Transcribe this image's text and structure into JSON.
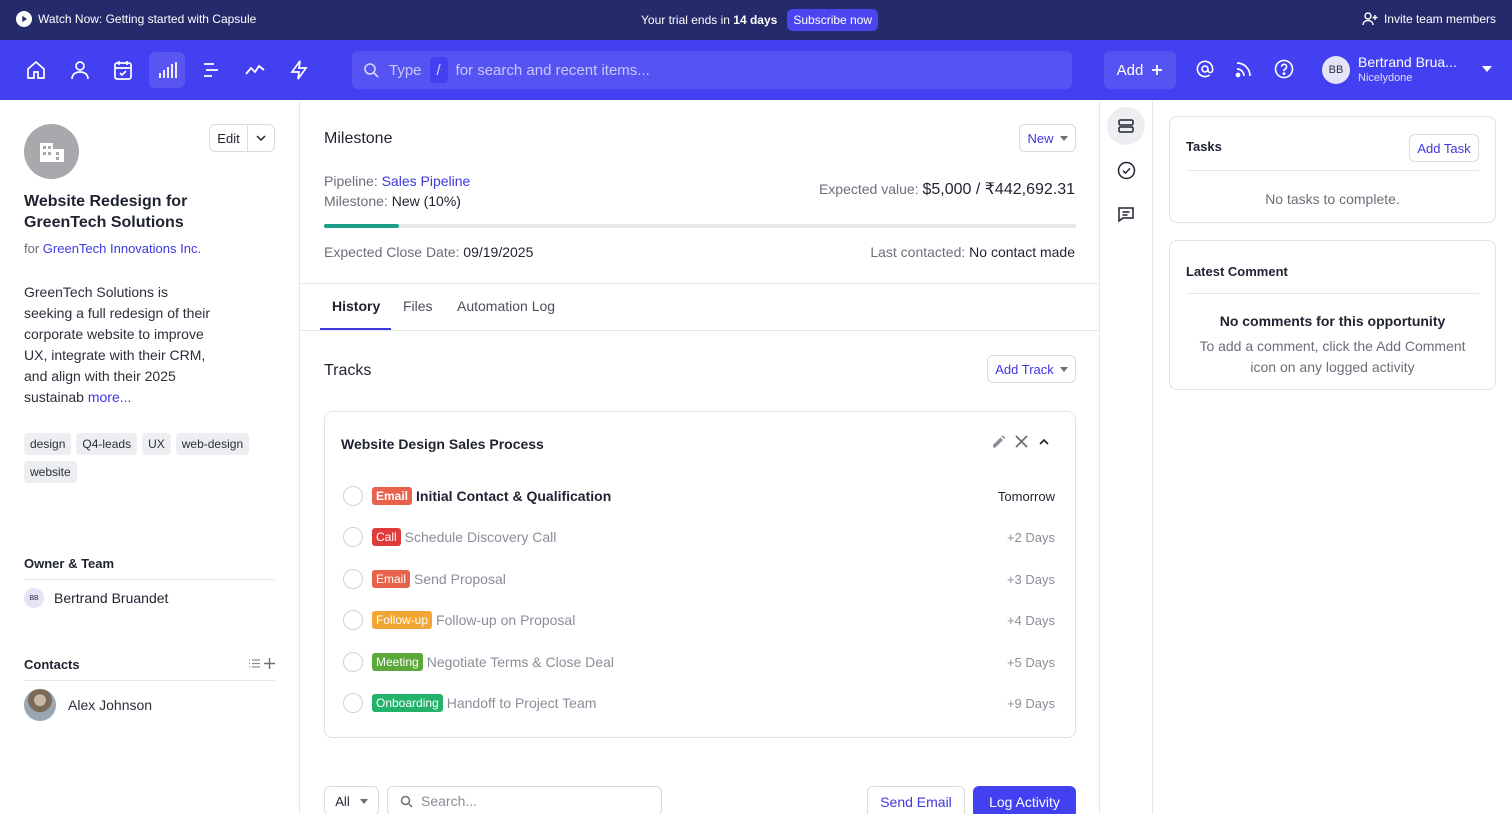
{
  "promo": {
    "watch_label": "Watch Now: Getting started with Capsule",
    "trial_prefix": "Your trial ends in",
    "trial_days": "14 days",
    "subscribe_label": "Subscribe now",
    "invite_label": "Invite team members"
  },
  "nav": {
    "icons": [
      "home-icon",
      "person-icon",
      "calendar-icon",
      "pipeline-icon",
      "projects-icon",
      "reports-icon",
      "workflow-icon"
    ],
    "search_prefix": "Type",
    "search_slash": "/",
    "search_suffix": "for search and recent items...",
    "add_label": "Add",
    "user_initials": "BB",
    "user_name": "Bertrand Brua...",
    "user_org": "Nicelydone"
  },
  "opportunity": {
    "edit_label": "Edit",
    "title": "Website Redesign for GreenTech Solutions",
    "for_prefix": "for",
    "for_org": "GreenTech Innovations Inc.",
    "description": "GreenTech Solutions is seeking a full redesign of their corporate website to improve UX, integrate with their CRM, and align with their 2025 sustainab",
    "more_label": "more...",
    "tags": [
      "design",
      "Q4-leads",
      "UX",
      "web-design",
      "website"
    ],
    "owner_title": "Owner & Team",
    "owner_initials": "BB",
    "owner_name": "Bertrand Bruandet",
    "contacts_title": "Contacts",
    "contact_name": "Alex Johnson"
  },
  "milestone": {
    "heading": "Milestone",
    "stage_button": "New",
    "pipeline_label": "Pipeline:",
    "pipeline_value": "Sales Pipeline",
    "milestone_label": "Milestone:",
    "milestone_value": "New (10%)",
    "expected_label": "Expected value:",
    "expected_value": "$5,000 / ₹442,692.31",
    "progress_percent": 10,
    "close_label": "Expected Close Date:",
    "close_value": "09/19/2025",
    "contacted_label": "Last contacted:",
    "contacted_value": "No contact made"
  },
  "tabs": [
    "History",
    "Files",
    "Automation Log"
  ],
  "tracks": {
    "title": "Tracks",
    "add_label": "Add Track",
    "card_title": "Website Design Sales Process",
    "items": [
      {
        "badge": "Email",
        "name": "Initial Contact & Qualification",
        "due": "Tomorrow"
      },
      {
        "badge": "Call",
        "name": "Schedule Discovery Call",
        "due": "+2 Days"
      },
      {
        "badge": "Email",
        "name": "Send Proposal",
        "due": "+3 Days"
      },
      {
        "badge": "Follow-up",
        "name": "Follow-up on Proposal",
        "due": "+4 Days"
      },
      {
        "badge": "Meeting",
        "name": "Negotiate Terms & Close Deal",
        "due": "+5 Days"
      },
      {
        "badge": "Onboarding",
        "name": "Handoff to Project Team",
        "due": "+9 Days"
      }
    ]
  },
  "activity": {
    "filter_value": "All",
    "search_placeholder": "Search...",
    "send_email_label": "Send Email",
    "log_activity_label": "Log Activity"
  },
  "right": {
    "tasks_title": "Tasks",
    "add_task_label": "Add Task",
    "no_tasks": "No tasks to complete.",
    "comment_title": "Latest Comment",
    "no_comments_title": "No comments for this opportunity",
    "no_comments_body": "To add a comment, click the Add Comment icon on any logged activity"
  },
  "colors": {
    "nav": "#4240f0",
    "promo": "#252a6b",
    "accent": "#3d38e0",
    "progress": "#1b9e8a",
    "badge_email": "#e8624b",
    "badge_call": "#e03b3b",
    "badge_followup": "#f1a532",
    "badge_meeting": "#5ca83a",
    "badge_onboarding": "#23b26a"
  }
}
